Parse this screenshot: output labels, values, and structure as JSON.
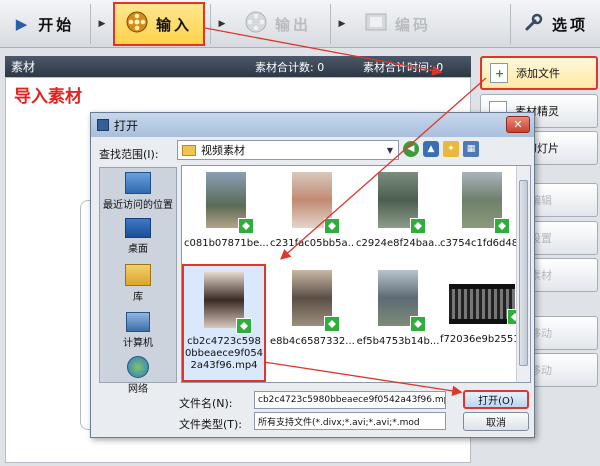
{
  "toolbar": {
    "start_label": "开始",
    "input_label": "输入",
    "output_label": "输出",
    "edit_label": "编码",
    "options_label": "选项"
  },
  "panel": {
    "title": "素材",
    "total_count": "素材合计数: 0",
    "total_time": "素材合计时间: 0",
    "import_heading": "导入素材"
  },
  "side_buttons": [
    {
      "label": "添加文件"
    },
    {
      "label": "素材精灵"
    },
    {
      "label": "加幻灯片"
    },
    {
      "label": "切编辑"
    },
    {
      "label": "删设置"
    },
    {
      "label": "除素材"
    },
    {
      "label": "上移动"
    },
    {
      "label": "下移动"
    }
  ],
  "dialog": {
    "title": "打开",
    "look_in_label": "查找范围(I):",
    "look_in_value": "视频素材",
    "places": [
      {
        "label": "最近访问的位置",
        "icon": "recent-places-icon"
      },
      {
        "label": "桌面",
        "icon": "desktop-icon"
      },
      {
        "label": "库",
        "icon": "library-icon"
      },
      {
        "label": "计算机",
        "icon": "computer-icon"
      },
      {
        "label": "网络",
        "icon": "network-icon"
      }
    ],
    "files": [
      {
        "name": "c081b07871be..."
      },
      {
        "name": "c231fac05bb5a..."
      },
      {
        "name": "c2924e8f24baa..."
      },
      {
        "name": "c3754c1fd6d48..."
      },
      {
        "name": "cb2c4723c5980bbeaece9f0542a43f96.mp4"
      },
      {
        "name": "e8b4c6587332..."
      },
      {
        "name": "ef5b4753b14b..."
      },
      {
        "name": "f72036e9b2551..."
      }
    ],
    "file_name_label": "文件名(N):",
    "file_name_value": "cb2c4723c5980bbeaece9f0542a43f96.mp4",
    "file_type_label": "文件类型(T):",
    "file_type_value": "所有支持文件(*.divx;*.avi;*.avi;*.mod",
    "open_button": "打开(O)",
    "cancel_button": "取消"
  },
  "colors": {
    "highlight_red": "#e0352b",
    "badge_green": "#2fae3c",
    "header_dark": "#2d3845"
  }
}
